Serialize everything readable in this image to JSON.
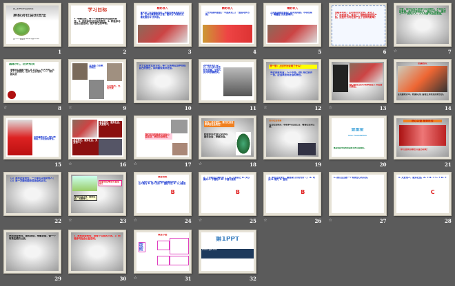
{
  "slides": [
    {
      "n": "1",
      "anim": false,
      "bg": "#fff",
      "title": "承担对社会的责任",
      "title_color": "#333",
      "subtitle": "第二课 承担对社会的责任",
      "body": "第一PPT模板网 www.1ppt.com",
      "body_color": "#333",
      "layout": "cover"
    },
    {
      "n": "2",
      "anim": false,
      "bg": "#fff",
      "title": "学习目标",
      "title_color": "#d03020",
      "body": "1. 明确公民、每个人都要承担对社会的责任；2. 怎样承担对社会的责任；3. 积极参与社会公益活动，提升自己的本领。",
      "body_color": "#222",
      "layout": "text"
    },
    {
      "n": "3",
      "anim": false,
      "bg": "#fff",
      "title": "精彩导入",
      "title_color": "#e02020",
      "body": "青天是一位出租车司机，他要求乘客系好安全带，主动为乘客提供方便，被评为\"文明的士、最优服务车\"的司机。",
      "body_color": "#1030d0",
      "layout": "photo-bottom"
    },
    {
      "n": "4",
      "anim": false,
      "bg": "#fff",
      "title": "精彩导入",
      "title_color": "#e02020",
      "body": "一份专版同报道了\"中国某化工厂\"造成河水污染。",
      "body_color": "#1030d0",
      "layout": "photo-bottom-red"
    },
    {
      "n": "5",
      "anim": false,
      "bg": "#fff",
      "title": "精彩导入",
      "title_color": "#e02020",
      "body": "几年前某地的食品厂向河流排放，市场出现了\"毒蘑菇\"的危害事件。",
      "body_color": "#1030d0",
      "layout": "photo-bottom"
    },
    {
      "n": "6",
      "anim": false,
      "bg": "#f4f8ff",
      "title": "",
      "title_color": "#e02020",
      "body": "出租车司机：主动系好安全带。某化工厂：排放废水。食品厂：销售假冒伪劣产品。这些行为对社会产生了怎样的影响？",
      "body_color": "#e02020",
      "layout": "dotted"
    },
    {
      "n": "7",
      "anim": true,
      "bg": "grad",
      "title": "",
      "title_color": "#1030d0",
      "body": "不管，因为这些不是我们应当做的，不是自己的事情。他们在帮助他人，做好了社会，赢得了一个\"我为人人，人人为我\"的社会氛围。",
      "body_color": "#108030",
      "layout": "text-grad"
    },
    {
      "n": "8",
      "anim": true,
      "bg": "#fff",
      "title": "国家兴亡 匹夫有责",
      "title_color": "#108030",
      "body": "谁最关心国家兴衰？天下兴亡，匹夫有责。先天下之忧而忧，后天下之乐而乐。——（明）顾炎武",
      "body_color": "#222",
      "layout": "text-seal"
    },
    {
      "n": "9",
      "anim": true,
      "bg": "#fff",
      "title": "吉鸿昌 方志敏 刘胡兰",
      "title_color": "#1030d0",
      "body": "生的伟大，死的光荣",
      "body_color": "#e02020",
      "layout": "portraits"
    },
    {
      "n": "10",
      "anim": false,
      "bg": "grad",
      "title": "",
      "title_color": "#1030d0",
      "body": "关于社会责任的讨论，每个公民都应当承担起自己的责任，共同建设美好社会。",
      "body_color": "#1030d0",
      "layout": "text-grad"
    },
    {
      "n": "11",
      "anim": false,
      "bg": "#fff",
      "title": "",
      "title_color": "#1030d0",
      "body": "2008年5月12日，四川汶川发生特大地震，全国人民共同抗震救灾。",
      "body_color": "#1030d0",
      "layout": "text-photo"
    },
    {
      "n": "12",
      "anim": true,
      "bg": "grad",
      "title": "想一想：上述行为说明了什么？",
      "title_color": "#e02020",
      "body": "维护国家利益，人人有责。我们是社会的一员，应当承担对社会的责任。",
      "body_color": "#1030d0",
      "layout": "yellow-title"
    },
    {
      "n": "13",
      "anim": true,
      "bg": "grad",
      "title": "",
      "title_color": "#e02020",
      "body": "他们用自己的行动承担起了对社会的责任。",
      "body_color": "#e02020",
      "layout": "photo-top"
    },
    {
      "n": "14",
      "anim": false,
      "bg": "grad",
      "title": "抗震救灾",
      "title_color": "#e02020",
      "body": "在抗震救灾中，救援队员们冒着生命危险抢救伤员。",
      "body_color": "#222",
      "layout": "photo-big"
    },
    {
      "n": "15",
      "anim": false,
      "bg": "#fff",
      "title": "",
      "title_color": "#1030d0",
      "body": "在抗震救灾中，他们承担起了对社会的责任。",
      "body_color": "#1030d0",
      "layout": "photo-left"
    },
    {
      "n": "16",
      "anim": true,
      "bg": "#fff",
      "title": "",
      "title_color": "#fff",
      "body": "承担责任，服务社会，关爱他人。",
      "body_color": "#fff",
      "layout": "maroon"
    },
    {
      "n": "17",
      "anim": true,
      "bg": "#fff",
      "title": "",
      "title_color": "#222",
      "body": "我们应当积极参与社会公益活动，承担社会责任。",
      "body_color": "#e02020",
      "layout": "pink-box"
    },
    {
      "n": "18",
      "anim": true,
      "bg": "grad",
      "title": "作为一名中学生，我们又该怎样承担社会责任？",
      "title_color": "#fff",
      "body": "积极参加社会公益活动，服务社会，奉献社会。",
      "body_color": "#222",
      "layout": "orange-tree"
    },
    {
      "n": "19",
      "anim": false,
      "bg": "grad",
      "title": "关心社会发展",
      "title_color": "#e06000",
      "body": "关注社会热点，积极参与社会生活，增强社会责任感。",
      "body_color": "#222",
      "layout": "text-photo-small"
    },
    {
      "n": "20",
      "anim": false,
      "bg": "#fff",
      "title": "壹基金",
      "title_color": "#3aa0d8",
      "subtitle": "One Foundation",
      "body": "壹基金是李连杰发起成立的公益组织。",
      "body_color": "#108030",
      "layout": "logo"
    },
    {
      "n": "21",
      "anim": false,
      "bg": "grad",
      "title": "热心公益 服务社会",
      "title_color": "#c02000",
      "body": "你们会参加哪些公益活动呢？",
      "body_color": "#e02020",
      "layout": "orange-photo"
    },
    {
      "n": "22",
      "anim": false,
      "bg": "grad",
      "title": "",
      "title_color": "#1030d0",
      "body": "（1）承担社会责任，一方面可以帮助他人；（2）另一方面也能获得社会的认可。",
      "body_color": "#1030d0",
      "layout": "text-grad"
    },
    {
      "n": "23",
      "anim": true,
      "bg": "grad",
      "title": "你参加过哪些公益活动？",
      "title_color": "#e02020",
      "body": "参加公益活动，服务社会，关爱他人。",
      "body_color": "#222",
      "layout": "cartoon"
    },
    {
      "n": "24",
      "anim": true,
      "bg": "#fff",
      "title": "课堂训练",
      "title_color": "#e02020",
      "body": "1. 下列行为中，属于承担社会责任的是（ ）A. 见义勇为 B. 助人为乐 C. 遵纪守法 D. 以上都是",
      "body_color": "#1030d0",
      "answer": "B",
      "layout": "quiz"
    },
    {
      "n": "25",
      "anim": true,
      "bg": "#fff",
      "title": "",
      "title_color": "#1030d0",
      "body": "2. 下列做法正确的是（ ）A. 只顾自己 B. 关心集体 C. 不管他人 D. 不遵守规则",
      "body_color": "#1030d0",
      "answer": "B",
      "layout": "quiz"
    },
    {
      "n": "26",
      "anim": true,
      "bg": "#fff",
      "title": "",
      "title_color": "#1030d0",
      "body": "3. 承担社会责任，需要我们付出代价（ ）A. 时间 B. 精力 C. 金钱",
      "body_color": "#1030d0",
      "answer": "B",
      "layout": "quiz"
    },
    {
      "n": "27",
      "anim": true,
      "bg": "#fff",
      "title": "",
      "title_color": "#1030d0",
      "body": "4. 我们应当做一个有责任心的公民。",
      "body_color": "#1030d0",
      "answer": "",
      "layout": "quiz"
    },
    {
      "n": "28",
      "anim": false,
      "bg": "#fff",
      "title": "",
      "title_color": "#1030d0",
      "body": "5. 关爱他人，服务社会。A. ① B. ② C. ③ D. ④",
      "body_color": "#1030d0",
      "answer": "C",
      "layout": "quiz"
    },
    {
      "n": "29",
      "anim": false,
      "bg": "grad",
      "title": "",
      "title_color": "#111",
      "body": "承担社会责任，服务社会，奉献社会，做一个有责任感的公民。",
      "body_color": "#111",
      "layout": "text-grad"
    },
    {
      "n": "30",
      "anim": false,
      "bg": "grad",
      "title": "",
      "title_color": "#e02020",
      "body": "1. 承担社会责任，是每个公民的义务。2. 积极参与社会公益活动。",
      "body_color": "#ff1010",
      "layout": "text-grad"
    },
    {
      "n": "31",
      "anim": true,
      "bg": "#fff",
      "title": "课堂小结",
      "title_color": "#e02020",
      "body": "承担对社会的责任",
      "body_color": "#1030d0",
      "layout": "mindmap"
    },
    {
      "n": "32",
      "anim": false,
      "bg": "#fff",
      "title": "第1PPT",
      "title_color": "#3a7fc0",
      "body": "www.1ppt.com",
      "body_color": "#fff",
      "layout": "brand"
    }
  ],
  "anim_icon": "☆"
}
